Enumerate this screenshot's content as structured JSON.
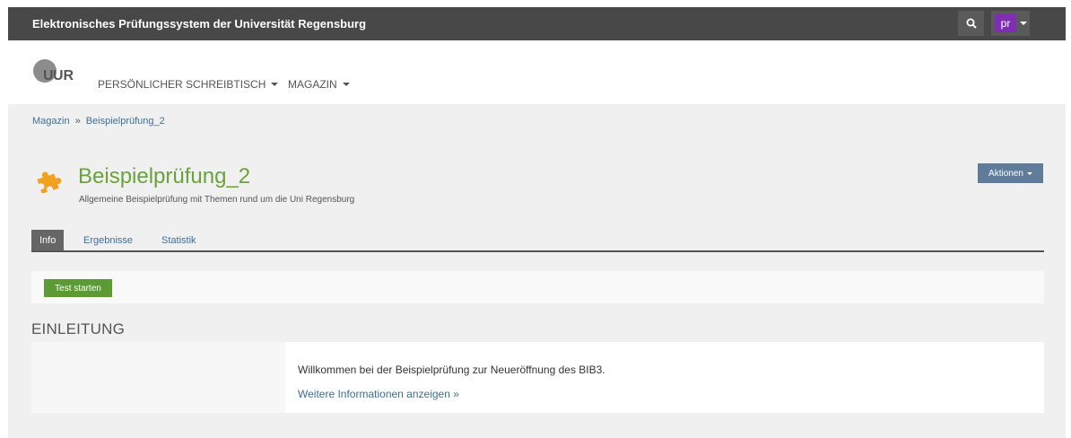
{
  "app": {
    "title": "Elektronisches Prüfungssystem der Universität Regensburg"
  },
  "user": {
    "initials": "pr",
    "avatar_color": "#7f2db5"
  },
  "logo": {
    "text": "UR"
  },
  "nav": [
    {
      "label": "PERSÖNLICHER SCHREIBTISCH"
    },
    {
      "label": "MAGAZIN"
    }
  ],
  "breadcrumb": {
    "items": [
      "Magazin",
      "Beispielprüfung_2"
    ],
    "separator": "»"
  },
  "page": {
    "title": "Beispielprüfung_2",
    "subtitle": "Allgemeine Beispielprüfung mit Themen rund um die Uni Regensburg",
    "icon": "puzzle-icon",
    "actions_label": "Aktionen"
  },
  "tabs": [
    {
      "label": "Info",
      "active": true
    },
    {
      "label": "Ergebnisse",
      "active": false
    },
    {
      "label": "Statistik",
      "active": false
    }
  ],
  "toolbar": {
    "start_label": "Test starten"
  },
  "intro": {
    "heading": "EINLEITUNG",
    "text": "Willkommen bei der Beispielprüfung zur Neueröffnung des BIB3.",
    "more_link": "Weitere Informationen anzeigen »"
  },
  "colors": {
    "accent_green": "#6aa23b",
    "link_blue": "#3f6f96",
    "topbar": "#484848",
    "actions_button": "#5f7c9b"
  }
}
